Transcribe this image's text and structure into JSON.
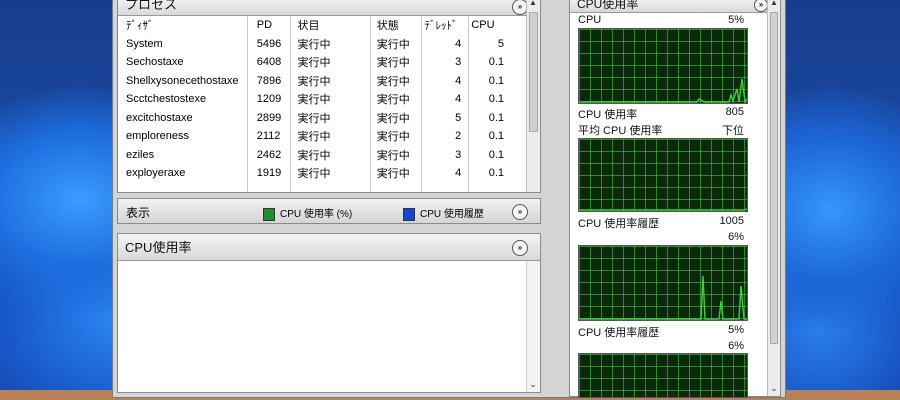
{
  "process_panel": {
    "title": "プロセス",
    "columns": [
      "ﾃﾞｨｻﾞ",
      "PD",
      "状目",
      "状態",
      "ﾃﾞﾚｯﾄﾞ",
      "CPU"
    ],
    "rows": [
      [
        "System",
        "5496",
        "実行中",
        "実行中",
        "4",
        "5"
      ],
      [
        "Sechostaxe",
        "6408",
        "実行中",
        "実行中",
        "3",
        "0.1"
      ],
      [
        "Shellxysonecethostaxe",
        "7896",
        "実行中",
        "実行中",
        "4",
        "0.1"
      ],
      [
        "Scctchestostexe",
        "1209",
        "実行中",
        "実行中",
        "4",
        "0.1"
      ],
      [
        "excitchostaxe",
        "2899",
        "実行中",
        "実行中",
        "5",
        "0.1"
      ],
      [
        "emploreness",
        "2112",
        "実行中",
        "実行中",
        "2",
        "0.1"
      ],
      [
        "eziles",
        "2462",
        "実行中",
        "実行中",
        "3",
        "0.1"
      ],
      [
        "exployeraxe",
        "1919",
        "実行中",
        "実行中",
        "4",
        "0.1"
      ]
    ]
  },
  "legend_bar": {
    "label": "表示",
    "items": [
      {
        "label": "CPU 使用率 (%)",
        "color": "#1f8f2a"
      },
      {
        "label": "CPU 使用履歴",
        "color": "#1547d6"
      }
    ]
  },
  "usage_panel": {
    "title": "CPU使用率"
  },
  "cpu_panel": {
    "title": "CPU使用率",
    "top_label": "CPU",
    "top_value": "5%",
    "graphs": [
      {
        "label": "CPU 使用率",
        "value": "805",
        "sublabel": "平均 CPU 使用率",
        "subvalue": "下位"
      },
      {
        "label": "CPU 使用率履歴",
        "value": "1005",
        "sublabel": "",
        "subvalue": "6%"
      },
      {
        "label": "CPU 使用率履歴",
        "value": "5%",
        "sublabel": "",
        "subvalue": "6%"
      }
    ]
  },
  "colors": {
    "graph_bg": "#0a280a",
    "graph_grid": "#46c846",
    "graph_line": "#3cd23c"
  }
}
